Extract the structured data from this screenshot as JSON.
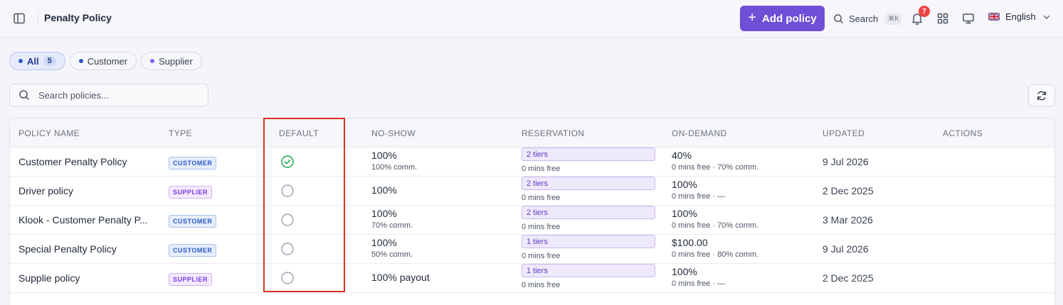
{
  "header": {
    "title": "Penalty Policy",
    "add_label": "Add policy",
    "search_label": "Search",
    "search_shortcut": "⌘K",
    "notification_count": "7",
    "language": "English"
  },
  "filters": {
    "all_label": "All",
    "all_count": "5",
    "customer_label": "Customer",
    "supplier_label": "Supplier",
    "colors": {
      "all": "#2b59c3",
      "customer": "#2b59c3",
      "supplier": "#8b5cf6"
    }
  },
  "search": {
    "placeholder": "Search policies..."
  },
  "table": {
    "columns": [
      "POLICY NAME",
      "TYPE",
      "DEFAULT",
      "NO-SHOW",
      "RESERVATION",
      "ON-DEMAND",
      "UPDATED",
      "ACTIONS"
    ],
    "rows": [
      {
        "name": "Customer Penalty Policy",
        "type": "CUSTOMER",
        "is_default": true,
        "no_show": "100%",
        "no_show_sub": "100% comm.",
        "reservation_tiers": "2 tiers",
        "reservation_sub": "0 mins free",
        "on_demand": "40%",
        "on_demand_sub": "0 mins free · 70% comm.",
        "updated": "9 Jul 2026"
      },
      {
        "name": "Driver policy",
        "type": "SUPPLIER",
        "is_default": false,
        "no_show": "100%",
        "no_show_sub": "",
        "reservation_tiers": "2 tiers",
        "reservation_sub": "0 mins free",
        "on_demand": "100%",
        "on_demand_sub": "0 mins free · —",
        "updated": "2 Dec 2025"
      },
      {
        "name": "Klook - Customer Penalty P...",
        "type": "CUSTOMER",
        "is_default": false,
        "no_show": "100%",
        "no_show_sub": "70% comm.",
        "reservation_tiers": "2 tiers",
        "reservation_sub": "0 mins free",
        "on_demand": "100%",
        "on_demand_sub": "0 mins free · 70% comm.",
        "updated": "3 Mar 2026"
      },
      {
        "name": "Special Penalty Policy",
        "type": "CUSTOMER",
        "is_default": false,
        "no_show": "100%",
        "no_show_sub": "50% comm.",
        "reservation_tiers": "1 tiers",
        "reservation_sub": "0 mins free",
        "on_demand": "$100.00",
        "on_demand_sub": "0 mins free · 80% comm.",
        "updated": "9 Jul 2026"
      },
      {
        "name": "Supplie policy",
        "type": "SUPPLIER",
        "is_default": false,
        "no_show": "100% payout",
        "no_show_sub": "",
        "reservation_tiers": "1 tiers",
        "reservation_sub": "0 mins free",
        "on_demand": "100%",
        "on_demand_sub": "0 mins free · —",
        "updated": "2 Dec 2025"
      }
    ]
  },
  "colors": {
    "accent": "#6f4fd6",
    "default_check": "#16a34a",
    "highlight": "#d93025"
  }
}
